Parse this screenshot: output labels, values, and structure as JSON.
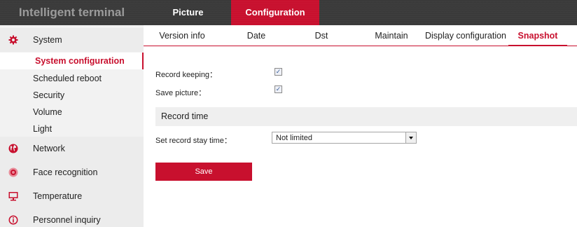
{
  "app": {
    "title": "Intelligent terminal"
  },
  "top_tabs": [
    {
      "label": "Picture"
    },
    {
      "label": "Configuration",
      "active": true
    }
  ],
  "colors": {
    "accent": "#c8102e",
    "topbar": "#3a3a3a",
    "sidebar": "#f2f2f2"
  },
  "sidebar": {
    "system": {
      "label": "System",
      "icon": "gear-icon",
      "items": [
        {
          "label": "System configuration",
          "active": true
        },
        {
          "label": "Scheduled reboot"
        },
        {
          "label": "Security"
        },
        {
          "label": "Volume"
        },
        {
          "label": "Light"
        }
      ]
    },
    "groups": [
      {
        "label": "Network",
        "icon": "globe-icon"
      },
      {
        "label": "Face recognition",
        "icon": "face-recognition-icon"
      },
      {
        "label": "Temperature",
        "icon": "monitor-icon"
      },
      {
        "label": "Personnel inquiry",
        "icon": "info-icon"
      }
    ]
  },
  "tabs": [
    {
      "label": "Version info"
    },
    {
      "label": "Date"
    },
    {
      "label": "Dst"
    },
    {
      "label": "Maintain"
    },
    {
      "label": "Display configuration"
    },
    {
      "label": "Snapshot",
      "active": true
    }
  ],
  "form": {
    "record_keeping": {
      "label": "Record keeping：",
      "checked": true
    },
    "save_picture": {
      "label": "Save picture：",
      "checked": true
    },
    "section_title": "Record time",
    "stay_time": {
      "label": "Set record stay time：",
      "value": "Not limited"
    },
    "save_label": "Save"
  }
}
